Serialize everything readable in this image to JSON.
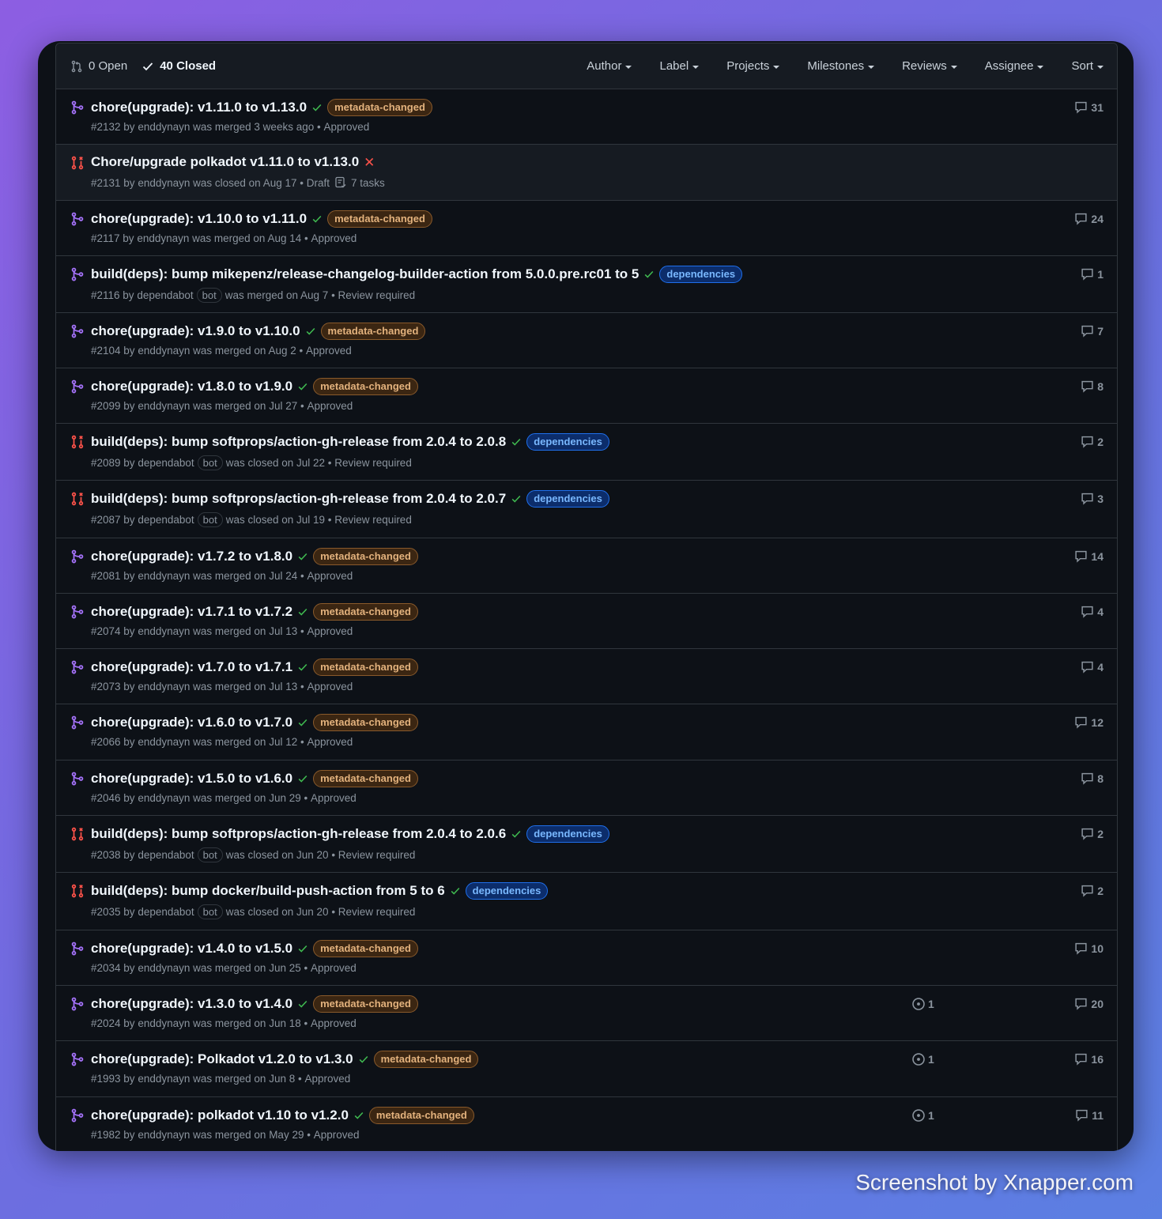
{
  "header": {
    "open_label": "0 Open",
    "closed_label": "40 Closed",
    "filters": [
      "Author",
      "Label",
      "Projects",
      "Milestones",
      "Reviews",
      "Assignee",
      "Sort"
    ]
  },
  "colors": {
    "merged_icon": "#a371f7",
    "closed_icon": "#f85149",
    "check": "#3fb950"
  },
  "prs": [
    {
      "state": "merged",
      "title": "chore(upgrade): v1.11.0 to v1.13.0",
      "status": "check",
      "label": "metadata-changed",
      "label_kind": "meta",
      "number": "#2132",
      "author": "enddynayn",
      "bot": "",
      "action": "was merged 3 weeks ago",
      "review": "Approved",
      "tasks": "",
      "issues": "",
      "comments": "31",
      "highlight": false
    },
    {
      "state": "closed",
      "title": "Chore/upgrade polkadot v1.11.0 to v1.13.0",
      "status": "x",
      "label": "",
      "label_kind": "",
      "number": "#2131",
      "author": "enddynayn",
      "bot": "",
      "action": "was closed on Aug 17",
      "review": "Draft",
      "tasks": "7 tasks",
      "issues": "",
      "comments": "",
      "highlight": true
    },
    {
      "state": "merged",
      "title": "chore(upgrade): v1.10.0 to v1.11.0",
      "status": "check",
      "label": "metadata-changed",
      "label_kind": "meta",
      "number": "#2117",
      "author": "enddynayn",
      "bot": "",
      "action": "was merged on Aug 14",
      "review": "Approved",
      "tasks": "",
      "issues": "",
      "comments": "24",
      "highlight": false
    },
    {
      "state": "merged",
      "title": "build(deps): bump mikepenz/release-changelog-builder-action from 5.0.0.pre.rc01 to 5",
      "status": "check",
      "label": "dependencies",
      "label_kind": "deps",
      "number": "#2116",
      "author": "dependabot",
      "bot": "bot",
      "action": "was merged on Aug 7",
      "review": "Review required",
      "tasks": "",
      "issues": "",
      "comments": "1",
      "highlight": false
    },
    {
      "state": "merged",
      "title": "chore(upgrade): v1.9.0 to v1.10.0",
      "status": "check",
      "label": "metadata-changed",
      "label_kind": "meta",
      "number": "#2104",
      "author": "enddynayn",
      "bot": "",
      "action": "was merged on Aug 2",
      "review": "Approved",
      "tasks": "",
      "issues": "",
      "comments": "7",
      "highlight": false
    },
    {
      "state": "merged",
      "title": "chore(upgrade): v1.8.0 to v1.9.0",
      "status": "check",
      "label": "metadata-changed",
      "label_kind": "meta",
      "number": "#2099",
      "author": "enddynayn",
      "bot": "",
      "action": "was merged on Jul 27",
      "review": "Approved",
      "tasks": "",
      "issues": "",
      "comments": "8",
      "highlight": false
    },
    {
      "state": "closed",
      "title": "build(deps): bump softprops/action-gh-release from 2.0.4 to 2.0.8",
      "status": "check",
      "label": "dependencies",
      "label_kind": "deps",
      "number": "#2089",
      "author": "dependabot",
      "bot": "bot",
      "action": "was closed on Jul 22",
      "review": "Review required",
      "tasks": "",
      "issues": "",
      "comments": "2",
      "highlight": false
    },
    {
      "state": "closed",
      "title": "build(deps): bump softprops/action-gh-release from 2.0.4 to 2.0.7",
      "status": "check",
      "label": "dependencies",
      "label_kind": "deps",
      "number": "#2087",
      "author": "dependabot",
      "bot": "bot",
      "action": "was closed on Jul 19",
      "review": "Review required",
      "tasks": "",
      "issues": "",
      "comments": "3",
      "highlight": false
    },
    {
      "state": "merged",
      "title": "chore(upgrade): v1.7.2 to v1.8.0",
      "status": "check",
      "label": "metadata-changed",
      "label_kind": "meta",
      "number": "#2081",
      "author": "enddynayn",
      "bot": "",
      "action": "was merged on Jul 24",
      "review": "Approved",
      "tasks": "",
      "issues": "",
      "comments": "14",
      "highlight": false
    },
    {
      "state": "merged",
      "title": "chore(upgrade): v1.7.1 to v1.7.2",
      "status": "check",
      "label": "metadata-changed",
      "label_kind": "meta",
      "number": "#2074",
      "author": "enddynayn",
      "bot": "",
      "action": "was merged on Jul 13",
      "review": "Approved",
      "tasks": "",
      "issues": "",
      "comments": "4",
      "highlight": false
    },
    {
      "state": "merged",
      "title": "chore(upgrade): v1.7.0 to v1.7.1",
      "status": "check",
      "label": "metadata-changed",
      "label_kind": "meta",
      "number": "#2073",
      "author": "enddynayn",
      "bot": "",
      "action": "was merged on Jul 13",
      "review": "Approved",
      "tasks": "",
      "issues": "",
      "comments": "4",
      "highlight": false
    },
    {
      "state": "merged",
      "title": "chore(upgrade): v1.6.0 to v1.7.0",
      "status": "check",
      "label": "metadata-changed",
      "label_kind": "meta",
      "number": "#2066",
      "author": "enddynayn",
      "bot": "",
      "action": "was merged on Jul 12",
      "review": "Approved",
      "tasks": "",
      "issues": "",
      "comments": "12",
      "highlight": false
    },
    {
      "state": "merged",
      "title": "chore(upgrade): v1.5.0 to v1.6.0",
      "status": "check",
      "label": "metadata-changed",
      "label_kind": "meta",
      "number": "#2046",
      "author": "enddynayn",
      "bot": "",
      "action": "was merged on Jun 29",
      "review": "Approved",
      "tasks": "",
      "issues": "",
      "comments": "8",
      "highlight": false
    },
    {
      "state": "closed",
      "title": "build(deps): bump softprops/action-gh-release from 2.0.4 to 2.0.6",
      "status": "check",
      "label": "dependencies",
      "label_kind": "deps",
      "number": "#2038",
      "author": "dependabot",
      "bot": "bot",
      "action": "was closed on Jun 20",
      "review": "Review required",
      "tasks": "",
      "issues": "",
      "comments": "2",
      "highlight": false
    },
    {
      "state": "closed",
      "title": "build(deps): bump docker/build-push-action from 5 to 6",
      "status": "check",
      "label": "dependencies",
      "label_kind": "deps",
      "number": "#2035",
      "author": "dependabot",
      "bot": "bot",
      "action": "was closed on Jun 20",
      "review": "Review required",
      "tasks": "",
      "issues": "",
      "comments": "2",
      "highlight": false
    },
    {
      "state": "merged",
      "title": "chore(upgrade): v1.4.0 to v1.5.0",
      "status": "check",
      "label": "metadata-changed",
      "label_kind": "meta",
      "number": "#2034",
      "author": "enddynayn",
      "bot": "",
      "action": "was merged on Jun 25",
      "review": "Approved",
      "tasks": "",
      "issues": "",
      "comments": "10",
      "highlight": false
    },
    {
      "state": "merged",
      "title": "chore(upgrade): v1.3.0 to v1.4.0",
      "status": "check",
      "label": "metadata-changed",
      "label_kind": "meta",
      "number": "#2024",
      "author": "enddynayn",
      "bot": "",
      "action": "was merged on Jun 18",
      "review": "Approved",
      "tasks": "",
      "issues": "1",
      "comments": "20",
      "highlight": false
    },
    {
      "state": "merged",
      "title": "chore(upgrade): Polkadot v1.2.0 to v1.3.0",
      "status": "check",
      "label": "metadata-changed",
      "label_kind": "meta",
      "number": "#1993",
      "author": "enddynayn",
      "bot": "",
      "action": "was merged on Jun 8",
      "review": "Approved",
      "tasks": "",
      "issues": "1",
      "comments": "16",
      "highlight": false
    },
    {
      "state": "merged",
      "title": "chore(upgrade): polkadot v1.10 to v1.2.0",
      "status": "check",
      "label": "metadata-changed",
      "label_kind": "meta",
      "number": "#1982",
      "author": "enddynayn",
      "bot": "",
      "action": "was merged on May 29",
      "review": "Approved",
      "tasks": "",
      "issues": "1",
      "comments": "11",
      "highlight": false
    }
  ],
  "watermark": "Screenshot by Xnapper.com"
}
